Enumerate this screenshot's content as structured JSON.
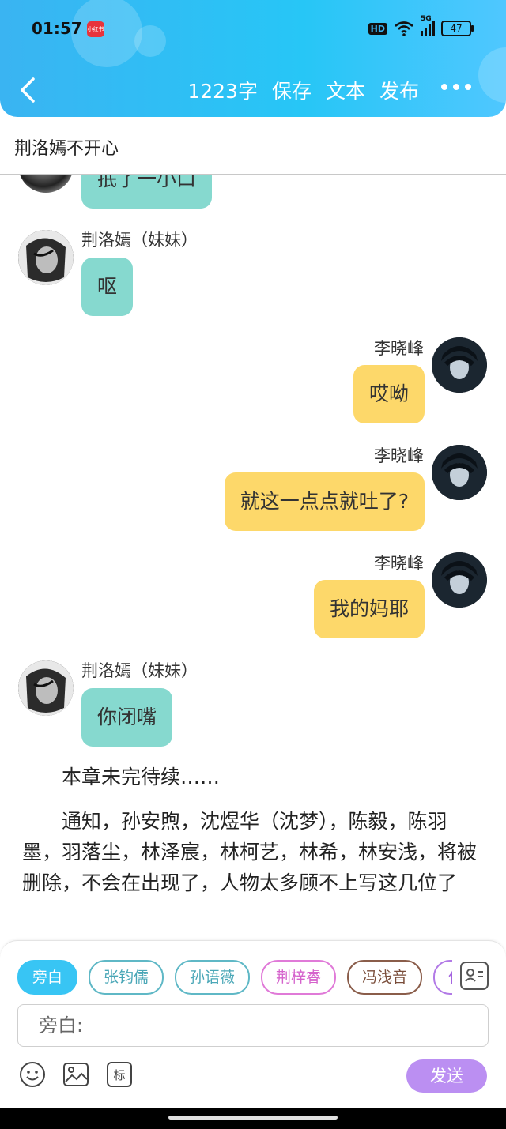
{
  "status_bar": {
    "time": "01:57",
    "app_badge": "小红书",
    "network_label": "HD",
    "signal_label": "5G",
    "battery": "47"
  },
  "header": {
    "word_count": "1223字",
    "save": "保存",
    "text": "文本",
    "publish": "发布"
  },
  "chapter_title": "荆洛嫣不开心",
  "messages": [
    {
      "side": "left",
      "speaker": "",
      "text": "抿了一小口"
    },
    {
      "side": "left",
      "speaker": "荆洛嫣（妹妹）",
      "text": "呕"
    },
    {
      "side": "right",
      "speaker": "李晓峰",
      "text": "哎呦"
    },
    {
      "side": "right",
      "speaker": "李晓峰",
      "text": "就这一点点就吐了?"
    },
    {
      "side": "right",
      "speaker": "李晓峰",
      "text": "我的妈耶"
    },
    {
      "side": "left",
      "speaker": "荆洛嫣（妹妹）",
      "text": "你闭嘴"
    }
  ],
  "paragraphs": [
    "本章未完待续……",
    "通知，孙安煦，沈煜华（沈梦），陈毅，陈羽墨，羽落尘，林泽宸，林柯艺，林希，林安浅，将被删除，不会在出现了，人物太多顾不上写这几位了"
  ],
  "composer": {
    "chips": [
      {
        "label": "旁白",
        "color": "#38c5f4",
        "active": true
      },
      {
        "label": "张钧儒",
        "color": "#5fb8c6",
        "active": false
      },
      {
        "label": "孙语薇",
        "color": "#5fb8c6",
        "active": false
      },
      {
        "label": "荆梓睿",
        "color": "#e07ad8",
        "active": false
      },
      {
        "label": "冯浅音",
        "color": "#8a5d4a",
        "active": false
      },
      {
        "label": "任",
        "color": "#b27ae6",
        "active": false
      }
    ],
    "input_placeholder": "旁白:",
    "send_label": "发送"
  }
}
